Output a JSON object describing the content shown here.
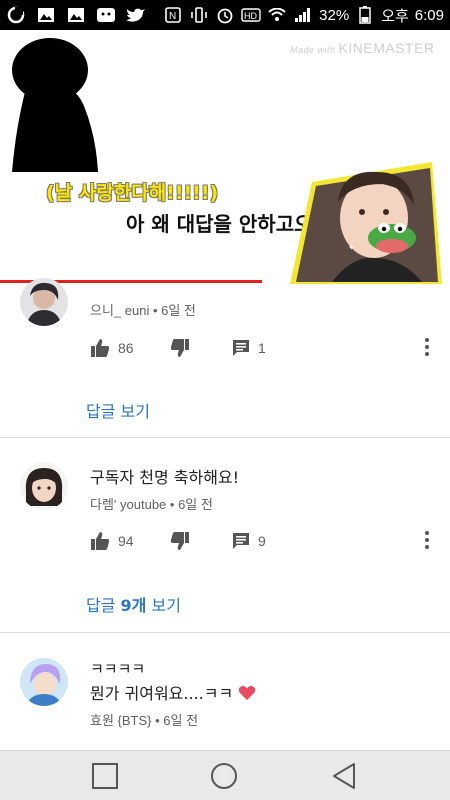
{
  "status_bar": {
    "battery_percent": "32%",
    "ampm": "오후",
    "time": "6:09",
    "hd_label": "HD",
    "icons": [
      "notification-icon",
      "gallery-icon",
      "kakao-icon",
      "twitter-icon",
      "nfc-icon",
      "vibrate-icon",
      "alarm-icon",
      "hd-voice-icon",
      "wifi-icon",
      "signal-icon",
      "battery-icon"
    ]
  },
  "video": {
    "watermark_small": "Made with",
    "watermark": "KINEMASTER",
    "caption_yellow": "(날 사랑한다해!!!!!)",
    "caption_black": "아 왜 대답을 안하고오"
  },
  "comments": [
    {
      "author": "으니_ euni",
      "time": "6일 전",
      "likes": "86",
      "replies": "1",
      "reply_link": "답글 보기"
    },
    {
      "text": "구독자 천명 축하해요!",
      "author": "다렘' youtube",
      "time": "6일 전",
      "likes": "94",
      "replies": "9",
      "reply_link_prefix": "답글 ",
      "reply_link_count": "9개",
      "reply_link_suffix": " 보기"
    },
    {
      "text_line1": "ㅋㅋㅋㅋ",
      "text_line2": "뭔가 귀여워요....ㅋㅋ",
      "emoji": "heart",
      "author": "효원 {BTS}",
      "time": "6일 전"
    }
  ],
  "colors": {
    "link": "#2a74c4",
    "meta": "#606060",
    "progress_red": "#e2201c",
    "caption_yellow": "#ffe600"
  }
}
